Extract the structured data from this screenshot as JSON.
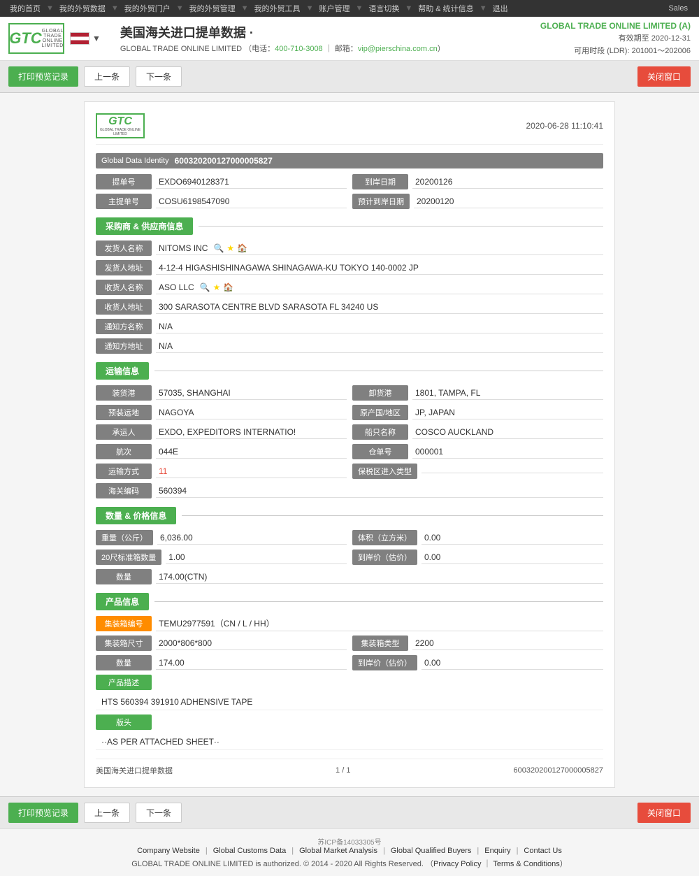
{
  "topNav": {
    "items": [
      "我的首页",
      "我的外贸数据",
      "我的外贸门户",
      "我的外贸管理",
      "我的外贸工具",
      "账户管理",
      "语言切换",
      "帮助 & 统计信息",
      "退出"
    ],
    "sales": "Sales"
  },
  "header": {
    "title": "美国海关进口提单数据 ·",
    "company": "GLOBAL TRADE ONLINE LIMITED",
    "phone": "400-710-3008",
    "email": "vip@pierschina.com.cn",
    "rightCompany": "GLOBAL TRADE ONLINE LIMITED (A)",
    "validUntil": "有效期至 2020-12-31",
    "ldrInfo": "可用时段 (LDR): 201001～202006"
  },
  "toolbar": {
    "printLabel": "打印预览记录",
    "prevLabel": "上一条",
    "nextLabel": "下一条",
    "closeLabel": "关闭窗口"
  },
  "record": {
    "datetime": "2020-06-28 11:10:41",
    "globalDataIdentity": {
      "label": "Global Data Identity",
      "value": "600320200127000005827"
    },
    "billNumber": {
      "label": "提单号",
      "value": "EXDO6940128371"
    },
    "arrivalDate": {
      "label": "到岸日期",
      "value": "20200126"
    },
    "masterBill": {
      "label": "主提单号",
      "value": "COSU6198547090"
    },
    "estimatedArrivalDate": {
      "label": "预计到岸日期",
      "value": "20200120"
    },
    "buyerSupplierSection": "采购商 & 供应商信息",
    "shipperName": {
      "label": "发货人名称",
      "value": "NITOMS INC"
    },
    "shipperAddress": {
      "label": "发货人地址",
      "value": "4-12-4 HIGASHISHINAGAWA SHINAGAWA-KU TOKYO 140-0002 JP"
    },
    "consigneeName": {
      "label": "收货人名称",
      "value": "ASO LLC"
    },
    "consigneeAddress": {
      "label": "收货人地址",
      "value": "300 SARASOTA CENTRE BLVD SARASOTA FL 34240 US"
    },
    "notifyName": {
      "label": "通知方名称",
      "value": "N/A"
    },
    "notifyAddress": {
      "label": "通知方地址",
      "value": "N/A"
    },
    "transportSection": "运输信息",
    "loadPort": {
      "label": "装货港",
      "value": "57035, SHANGHAI"
    },
    "unloadPort": {
      "label": "卸货港",
      "value": "1801, TAMPA, FL"
    },
    "preloadDestination": {
      "label": "预装运地",
      "value": "NAGOYA"
    },
    "originCountry": {
      "label": "原产国/地区",
      "value": "JP, JAPAN"
    },
    "carrier": {
      "label": "承运人",
      "value": "EXDO, EXPEDITORS INTERNATIO!"
    },
    "vesselName": {
      "label": "船只名称",
      "value": "COSCO AUCKLAND"
    },
    "voyage": {
      "label": "航次",
      "value": "044E"
    },
    "warehouseNumber": {
      "label": "仓单号",
      "value": "000001"
    },
    "transportMode": {
      "label": "运输方式",
      "value": "11",
      "isLink": true
    },
    "bonded": {
      "label": "保税区进入类型",
      "value": ""
    },
    "customsCode": {
      "label": "海关编码",
      "value": "560394"
    },
    "quantityPriceSection": "数量 & 价格信息",
    "weight": {
      "label": "重量（公斤）",
      "value": "6,036.00"
    },
    "volume": {
      "label": "体积（立方米）",
      "value": "0.00"
    },
    "containers20ft": {
      "label": "20尺标准箱数量",
      "value": "1.00"
    },
    "arrivalPrice": {
      "label": "到岸价（估价）",
      "value": "0.00"
    },
    "quantity": {
      "label": "数量",
      "value": "174.00(CTN)"
    },
    "productSection": "产品信息",
    "containerCode": {
      "label": "集装箱编号",
      "value": "TEMU2977591（CN / L / HH）"
    },
    "containerSize": {
      "label": "集装箱尺寸",
      "value": "2000*806*800"
    },
    "containerType": {
      "label": "集装箱类型",
      "value": "2200"
    },
    "productQuantity": {
      "label": "数量",
      "value": "174.00"
    },
    "productArrivalPrice": {
      "label": "到岸价（估价）",
      "value": "0.00"
    },
    "productDescLabel": "产品描述",
    "productDesc": "HTS 560394 391910 ADHENSIVE TAPE",
    "headLabel": "版头",
    "headContent": "··AS PER ATTACHED SHEET··",
    "footerLeft": "美国海关进口提单数据",
    "footerPage": "1 / 1",
    "footerRight": "600320200127000005827"
  },
  "bottomToolbar": {
    "printLabel": "打印预览记录",
    "prevLabel": "上一条",
    "nextLabel": "下一条",
    "closeLabel": "关闭窗口"
  },
  "footer": {
    "icp": "苏ICP备14033305号",
    "links": [
      "Company Website",
      "Global Customs Data",
      "Global Market Analysis",
      "Global Qualified Buyers",
      "Enquiry",
      "Contact Us"
    ],
    "copyright": "GLOBAL TRADE ONLINE LIMITED is authorized. © 2014 - 2020 All Rights Reserved.",
    "privacyPolicy": "Privacy Policy",
    "terms": "Terms & Conditions"
  }
}
